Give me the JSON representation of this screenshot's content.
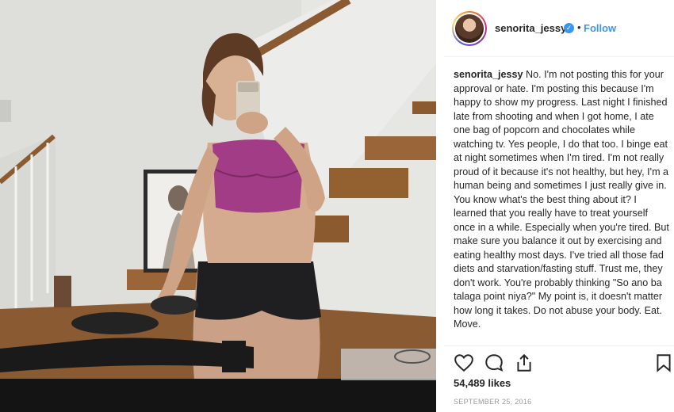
{
  "post": {
    "username": "senorita_jessy",
    "verified_badge_icon": "verified-check-icon",
    "separator": "•",
    "follow_label": "Follow",
    "caption_user": "senorita_jessy",
    "caption_text": "No. I'm not posting this for your approval or hate. I'm posting this because I'm happy to show my progress. Last night I finished late from shooting and when I got home, I ate one bag of popcorn and chocolates while watching tv. Yes people, I do that too. I binge eat at night sometimes when I'm tired. I'm not really proud of it because it's not healthy, but hey, I'm a human being and sometimes I just really give in. You know what's the best thing about it? I learned that you really have to treat yourself once in a while. Especially when you're tired. But make sure you balance it out by exercising and eating healthy most days. I've tried all those fad diets and starvation/fasting stuff. Trust me, they don't work. You're probably thinking \"So ano ba talaga point niya?\" My point is, it doesn't matter how long it takes. Do not abuse your body. Eat. Move.",
    "likes": "54,489 likes",
    "date": "SEPTEMBER 25, 2016"
  },
  "icons": {
    "like": "heart-icon",
    "comment": "comment-icon",
    "share": "share-icon",
    "save": "bookmark-icon"
  },
  "colors": {
    "link_blue": "#3897f0",
    "text": "#262626",
    "muted": "#999999",
    "divider": "#efefef"
  }
}
